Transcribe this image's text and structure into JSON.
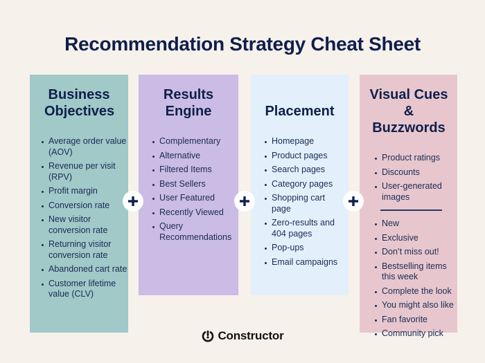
{
  "title": "Recommendation Strategy Cheat Sheet",
  "colors": {
    "background": "#f6f1ea",
    "heading": "#0f1e4c",
    "business_objectives": "#a0c9c8",
    "results_engine": "#cabce4",
    "placement": "#e3f0fc",
    "visual_cues": "#e7c7cd"
  },
  "columns": [
    {
      "heading": "Business Objectives",
      "items": [
        "Average order value (AOV)",
        "Revenue per visit (RPV)",
        "Profit margin",
        "Conversion rate",
        "New visitor conversion rate",
        "Returning visitor conversion rate",
        "Abandoned cart rate",
        "Customer lifetime value (CLV)"
      ]
    },
    {
      "heading": "Results Engine",
      "items": [
        "Complementary",
        "Alternative",
        "Filtered Items",
        "Best Sellers",
        "User Featured",
        "Recently Viewed",
        "Query Recommendations"
      ]
    },
    {
      "heading": "Placement",
      "items": [
        "Homepage",
        "Product pages",
        "Search pages",
        "Category pages",
        "Shopping cart page",
        "Zero-results and 404 pages",
        "Pop-ups",
        "Email campaigns"
      ]
    },
    {
      "heading": "Visual Cues & Buzzwords",
      "visual_cues": [
        "Product ratings",
        "Discounts",
        "User-generated images"
      ],
      "buzzwords": [
        "New",
        "Exclusive",
        "Don’t miss out!",
        "Bestselling items this week",
        "Complete the look",
        "You might also like",
        "Fan favorite",
        "Community pick"
      ]
    }
  ],
  "connectors": {
    "icon": "plus-icon",
    "count": 3
  },
  "footer": {
    "brand": "Constructor",
    "logo_icon": "power-icon"
  }
}
